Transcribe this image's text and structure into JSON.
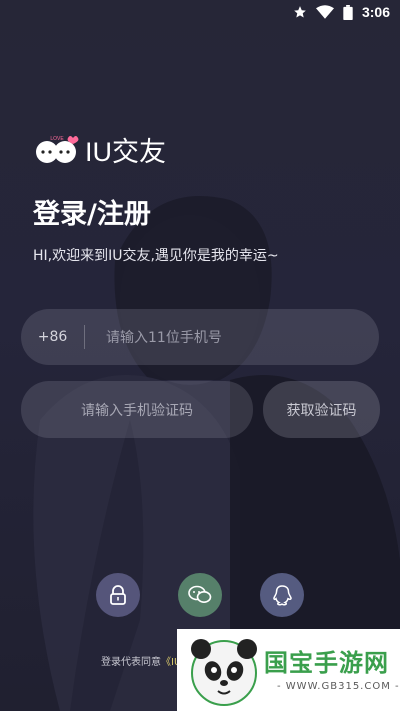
{
  "status_bar": {
    "time": "3:06"
  },
  "app": {
    "logo_text": "IU交友",
    "logo_badge": "LOVE"
  },
  "login": {
    "title": "登录/注册",
    "subtitle": "HI,欢迎来到IU交友,遇见你是我的幸运~",
    "country_code": "+86",
    "phone_placeholder": "请输入11位手机号",
    "code_placeholder": "请输入手机验证码",
    "get_code_label": "获取验证码"
  },
  "social_login": {
    "items": [
      {
        "icon": "lock-icon"
      },
      {
        "icon": "wechat-icon"
      },
      {
        "icon": "qq-icon"
      }
    ]
  },
  "agreement": {
    "prefix": "登录代表同意",
    "link": "《IU"
  },
  "watermark": {
    "text": "国宝手游网",
    "url": "- WWW.GB315.COM -"
  },
  "colors": {
    "background": "#25253a",
    "wechat": "#56806a",
    "lock": "#55557a",
    "qq": "#555b80",
    "watermark_green": "#3a9f4c"
  }
}
